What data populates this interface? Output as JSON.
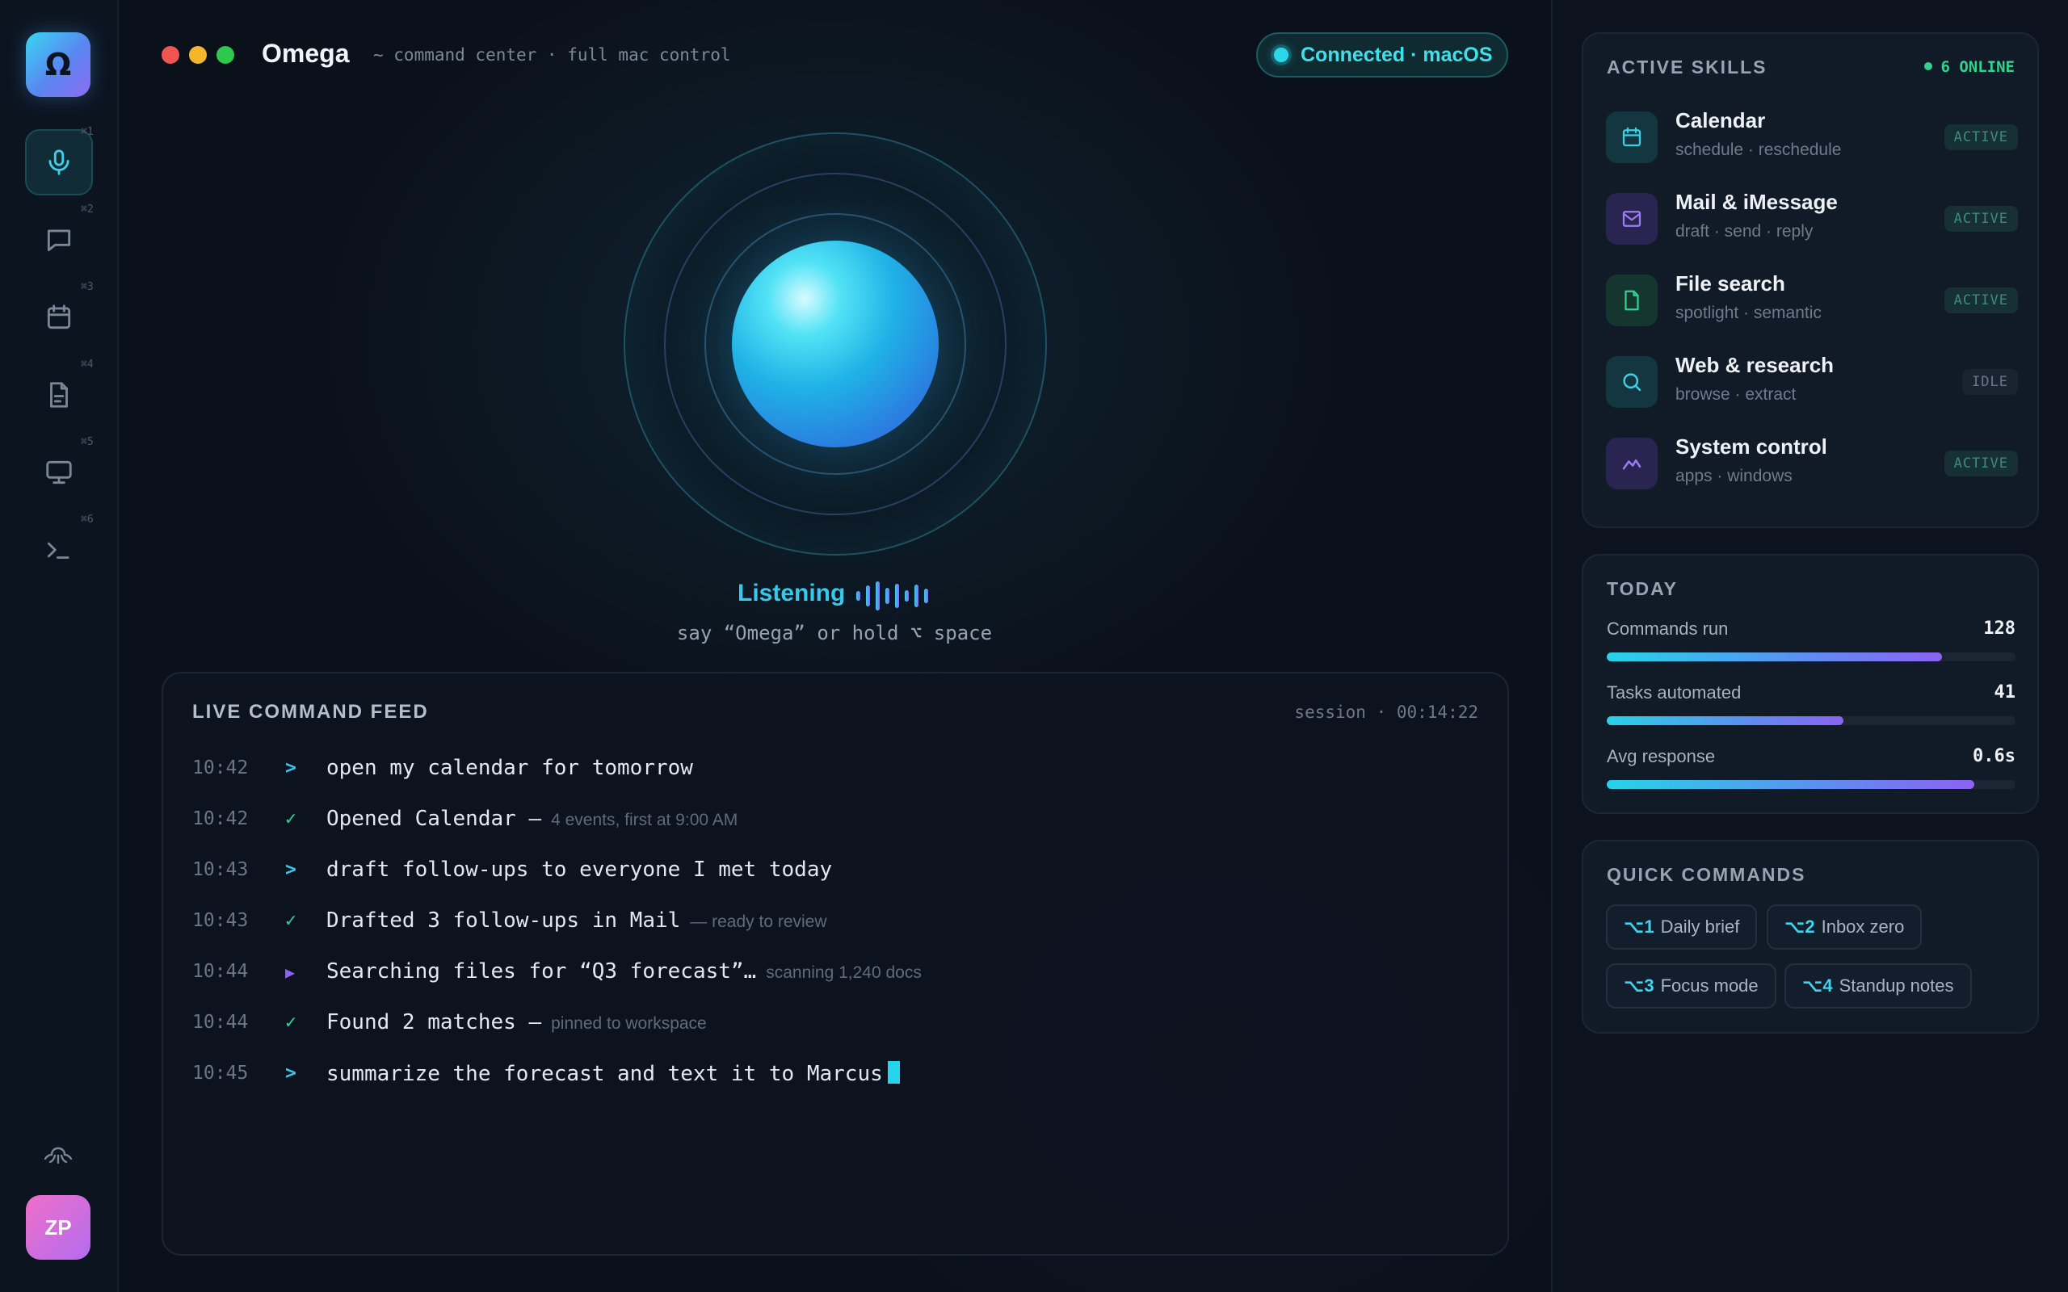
{
  "app": {
    "logo_glyph": "Ω",
    "title": "Omega",
    "subtitle": "~ command center · full mac control",
    "connection": "Connected · macOS"
  },
  "sidebar": {
    "items": [
      {
        "icon": "microphone-icon",
        "key": "⌘1",
        "active": true
      },
      {
        "icon": "chat-icon",
        "key": "⌘2"
      },
      {
        "icon": "calendar-icon",
        "key": "⌘3"
      },
      {
        "icon": "document-icon",
        "key": "⌘4"
      },
      {
        "icon": "monitor-icon",
        "key": "⌘5"
      },
      {
        "icon": "terminal-icon",
        "key": "⌘6"
      }
    ],
    "bottom_icon": "octopus-icon",
    "avatar_initials": "ZP"
  },
  "voice": {
    "status": "Listening",
    "hint": "say “Omega” or hold ⌥ space"
  },
  "feed": {
    "title": "LIVE COMMAND FEED",
    "session": "session · 00:14:22",
    "rows": [
      {
        "time": "10:42",
        "mark": ">",
        "kind": "command",
        "text": "open my calendar for tomorrow",
        "note": ""
      },
      {
        "time": "10:42",
        "mark": "✓",
        "kind": "result",
        "text": "Opened Calendar —",
        "note": "4 events, first at 9:00 AM"
      },
      {
        "time": "10:43",
        "mark": ">",
        "kind": "command",
        "text": "draft follow-ups to everyone I met today",
        "note": ""
      },
      {
        "time": "10:43",
        "mark": "✓",
        "kind": "result",
        "text": "Drafted 3 follow-ups in Mail",
        "note": "— ready to review"
      },
      {
        "time": "10:44",
        "mark": "▶",
        "kind": "running",
        "text": "Searching files for “Q3 forecast”…",
        "note": "scanning 1,240 docs"
      },
      {
        "time": "10:44",
        "mark": "✓",
        "kind": "result",
        "text": "Found 2 matches —",
        "note": "pinned to workspace"
      },
      {
        "time": "10:45",
        "mark": ">",
        "kind": "command",
        "text": "summarize the forecast and text it to Marcus",
        "note": ""
      }
    ]
  },
  "skills": {
    "title": "ACTIVE SKILLS",
    "online": "6 ONLINE",
    "items": [
      {
        "name": "Calendar",
        "sub": "schedule · reschedule",
        "badge": "ACTIVE",
        "icon": "calendar-icon"
      },
      {
        "name": "Mail & iMessage",
        "sub": "draft · send · reply",
        "badge": "ACTIVE",
        "icon": "mail-icon"
      },
      {
        "name": "File search",
        "sub": "spotlight · semantic",
        "badge": "ACTIVE",
        "icon": "file-icon"
      },
      {
        "name": "Web & research",
        "sub": "browse · extract",
        "badge": "IDLE",
        "icon": "search-icon"
      },
      {
        "name": "System control",
        "sub": "apps · windows",
        "badge": "ACTIVE",
        "icon": "activity-icon"
      }
    ]
  },
  "today": {
    "title": "TODAY",
    "stats": [
      {
        "label": "Commands run",
        "value": "128",
        "fill": 0.82
      },
      {
        "label": "Tasks automated",
        "value": "41",
        "fill": 0.58
      },
      {
        "label": "Avg response",
        "value": "0.6s",
        "fill": 0.9
      }
    ]
  },
  "quick": {
    "title": "QUICK COMMANDS",
    "chips": [
      {
        "key": "⌥1",
        "label": "Daily brief"
      },
      {
        "key": "⌥2",
        "label": "Inbox zero"
      },
      {
        "key": "⌥3",
        "label": "Focus mode"
      },
      {
        "key": "⌥4",
        "label": "Standup notes"
      }
    ]
  },
  "colors": {
    "accent": "#36c9ec",
    "purple": "#8c62f2",
    "success": "#34d08e"
  }
}
